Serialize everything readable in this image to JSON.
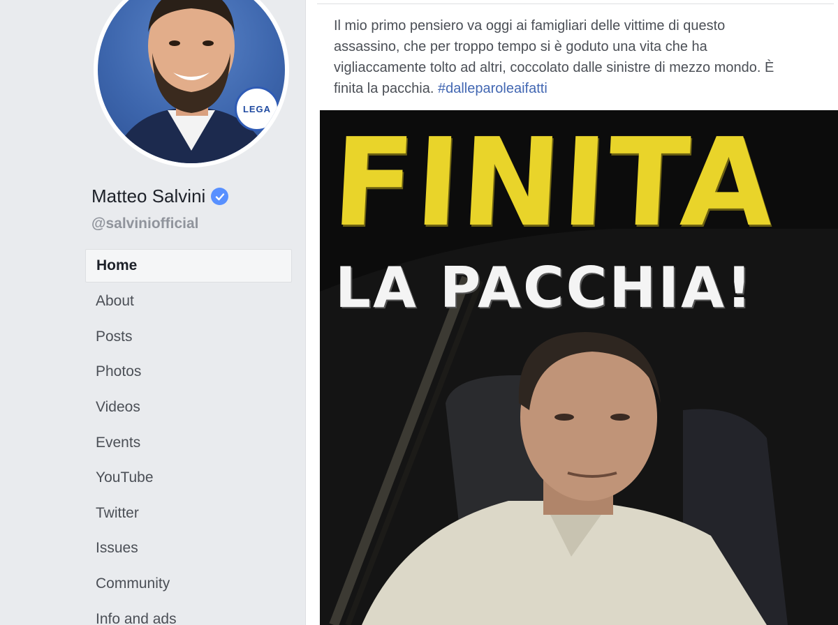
{
  "profile": {
    "name": "Matteo Salvini",
    "handle": "@salviniofficial",
    "badge_text": "LEGA",
    "verified_icon": "verified-check-icon"
  },
  "nav": {
    "items": [
      {
        "label": "Home",
        "active": true
      },
      {
        "label": "About"
      },
      {
        "label": "Posts"
      },
      {
        "label": "Photos"
      },
      {
        "label": "Videos"
      },
      {
        "label": "Events"
      },
      {
        "label": "YouTube"
      },
      {
        "label": "Twitter"
      },
      {
        "label": "Issues"
      },
      {
        "label": "Community"
      },
      {
        "label": "Info and ads"
      }
    ]
  },
  "post": {
    "line1": "Il mio primo pensiero va oggi ai famigliari delle vittime di questo",
    "line2": "assassino, che per troppo tempo si è goduto una vita che ha",
    "line3": "vigliaccamente tolto ad altri, coccolato dalle sinistre di mezzo mondo. È",
    "line4": "finita la pacchia.",
    "hashtag": "#dalleparoleaifatti",
    "image": {
      "headline_1": "FINITA",
      "headline_2": "LA PACCHIA!"
    }
  },
  "colors": {
    "page_bg": "#e9ebee",
    "link": "#4267b2",
    "verified": "#5890ff",
    "headline_yellow": "#e9d42a"
  }
}
